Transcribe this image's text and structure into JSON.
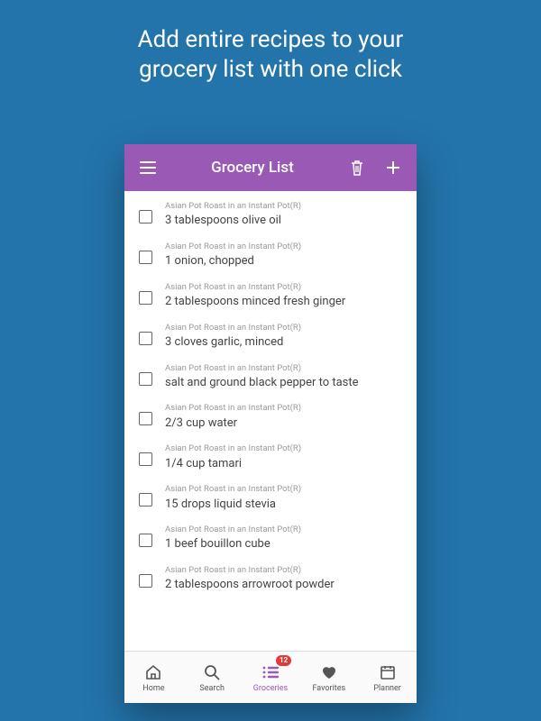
{
  "promo": {
    "line1": "Add entire recipes to your",
    "line2": "grocery list with one click"
  },
  "appbar": {
    "title": "Grocery List"
  },
  "source_recipe": "Asian Pot Roast in an Instant Pot(R)",
  "items": [
    {
      "text": "3 tablespoons olive oil"
    },
    {
      "text": "1 onion, chopped"
    },
    {
      "text": "2 tablespoons minced fresh ginger"
    },
    {
      "text": "3 cloves garlic, minced"
    },
    {
      "text": "salt and ground black pepper to taste"
    },
    {
      "text": "2/3 cup water"
    },
    {
      "text": "1/4 cup tamari"
    },
    {
      "text": "15 drops liquid stevia"
    },
    {
      "text": "1 beef bouillon cube"
    },
    {
      "text": "2 tablespoons arrowroot powder"
    }
  ],
  "tabs": {
    "home": "Home",
    "search": "Search",
    "groceries": "Groceries",
    "favorites": "Favorites",
    "planner": "Planner",
    "badge": "12"
  }
}
